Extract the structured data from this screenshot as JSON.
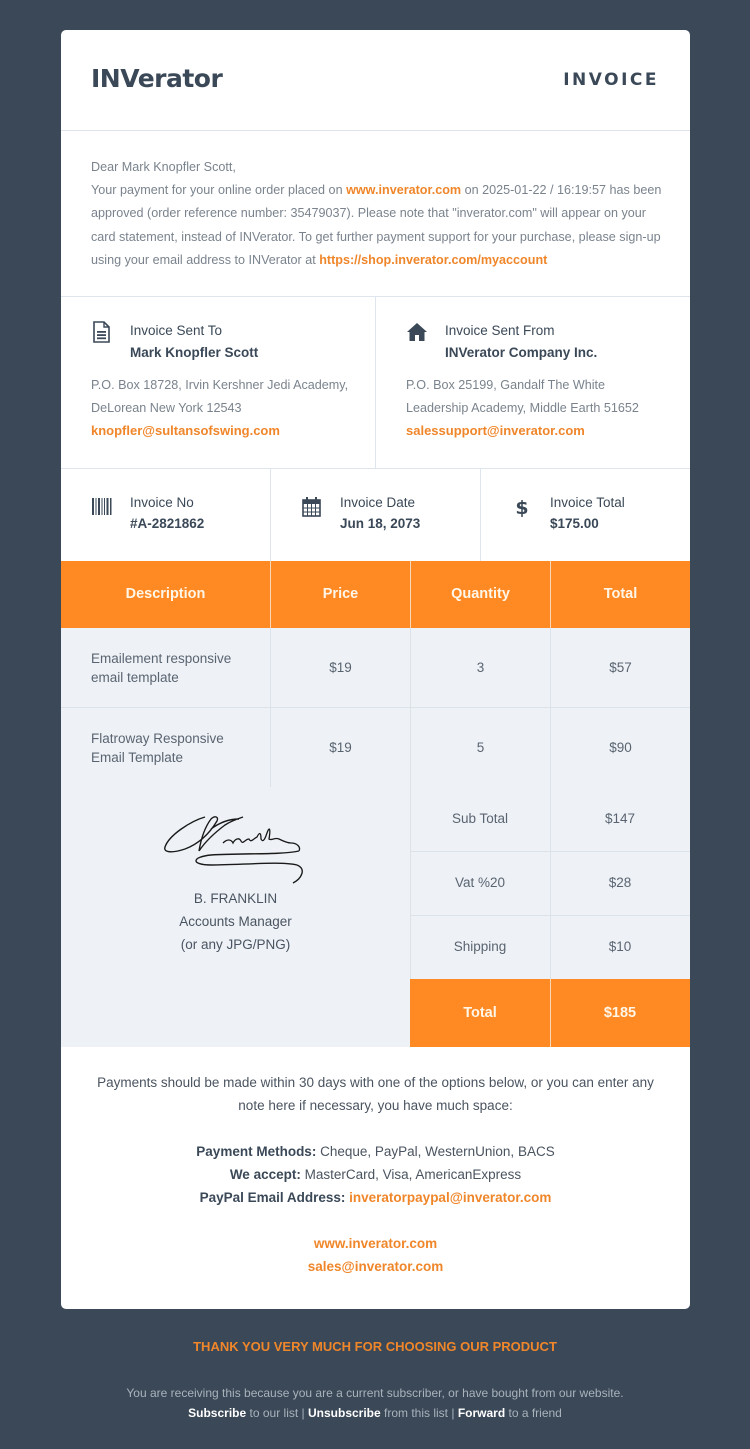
{
  "header": {
    "logo": "INVerator",
    "title": "INVOICE"
  },
  "greeting": {
    "salutation": "Dear Mark Knopfler Scott,",
    "text_1": "Your payment for your online order placed on ",
    "link_1": "www.inverator.com",
    "text_2": " on 2025-01-22 / 16:19:57 has been approved (order reference number: 35479037). Please note that \"inverator.com\" will appear on your card statement, instead of INVerator. To get further payment support for your purchase, please sign-up using your email address to INVerator at ",
    "link_2": "https://shop.inverator.com/myaccount"
  },
  "sent_to": {
    "icon": "document-icon",
    "label": "Invoice Sent To",
    "name": "Mark Knopfler Scott",
    "address": "P.O. Box 18728, Irvin Kershner Jedi Academy, DeLorean New York 12543",
    "email": "knopfler@sultansofswing.com"
  },
  "sent_from": {
    "icon": "home-icon",
    "label": "Invoice Sent From",
    "name": "INVerator Company Inc.",
    "address": "P.O. Box 25199, Gandalf The White Leadership Academy, Middle Earth 51652",
    "email": "salessupport@inverator.com"
  },
  "info": [
    {
      "icon": "barcode-icon",
      "label": "Invoice No",
      "value": "#A-2821862"
    },
    {
      "icon": "calendar-icon",
      "label": "Invoice Date",
      "value": "Jun 18, 2073"
    },
    {
      "icon": "dollar-icon",
      "label": "Invoice Total",
      "value": "$175.00"
    }
  ],
  "table": {
    "headers": [
      "Description",
      "Price",
      "Quantity",
      "Total"
    ],
    "rows": [
      {
        "description": "Emailement responsive email template",
        "price": "$19",
        "quantity": "3",
        "total": "$57"
      },
      {
        "description": "Flatroway Responsive Email Template",
        "price": "$19",
        "quantity": "5",
        "total": "$90"
      }
    ]
  },
  "summary": {
    "rows": [
      {
        "label": "Sub Total",
        "value": "$147"
      },
      {
        "label": "Vat %20",
        "value": "$28"
      },
      {
        "label": "Shipping",
        "value": "$10"
      }
    ],
    "total_label": "Total",
    "total_value": "$185"
  },
  "signature": {
    "name": "B. FRANKLIN",
    "role": "Accounts Manager",
    "note": "(or any JPG/PNG)"
  },
  "notes": {
    "text": "Payments should be made within 30 days with one of the options below, or you can enter any note here if necessary, you have much space:",
    "methods_label": "Payment Methods:",
    "methods_value": " Cheque, PayPal, WesternUnion, BACS",
    "accept_label": "We accept:",
    "accept_value": " MasterCard, Visa, AmericanExpress",
    "paypal_label": "PayPal Email Address: ",
    "paypal_value": "inveratorpaypal@inverator.com",
    "website": "www.inverator.com",
    "sales_email": "sales@inverator.com"
  },
  "footer": {
    "thanks": "THANK YOU VERY MUCH FOR CHOOSING OUR PRODUCT",
    "notice": "You are receiving this because you are a current subscriber, or have bought from our website.",
    "subscribe": "Subscribe",
    "subscribe_text": " to our list | ",
    "unsubscribe": "Unsubscribe",
    "unsubscribe_text": " from this list | ",
    "forward": "Forward",
    "forward_text": " to a friend"
  },
  "colors": {
    "accent": "#ff8a23",
    "link": "#f0862a",
    "background": "#3a4857",
    "row_bg": "#eef2f7"
  }
}
